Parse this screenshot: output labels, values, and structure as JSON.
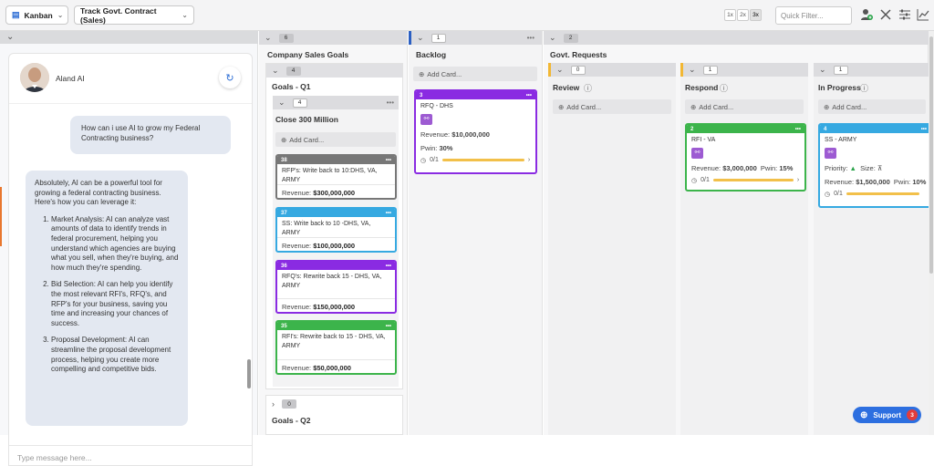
{
  "toolbar": {
    "view_label": "Kanban",
    "board_label": "Track Govt. Contract (Sales)",
    "zoom_levels": [
      "1x",
      "2x",
      "3x"
    ],
    "zoom_selected": "3x",
    "filter_placeholder": "Quick Filter...",
    "icons": [
      "add-user-icon",
      "tools-icon",
      "sliders-icon",
      "chart-icon"
    ]
  },
  "chat": {
    "assistant_name": "Aland AI",
    "user_message": "How can i use AI to grow my Federal Contracting business?",
    "ai_intro": "Absolutely, AI can be a powerful tool for growing a federal contracting business. Here's how you can leverage it:",
    "ai_points": [
      "Market Analysis: AI can analyze vast amounts of data to identify trends in federal procurement, helping you understand which agencies are buying what you sell, when they're buying, and how much they're spending.",
      "Bid Selection: AI can help you identify the most relevant RFI's, RFQ's, and RFP's for your business, saving you time and increasing your chances of success.",
      "Proposal Development: AI can streamline the proposal development process, helping you create more compelling and competitive bids."
    ],
    "input_placeholder": "Type message here..."
  },
  "board": {
    "add_card": "Add Card...",
    "company": {
      "title": "Company Sales Goals",
      "count": "6",
      "q1": {
        "title": "Goals - Q1",
        "count": "4"
      },
      "close": {
        "title": "Close 300 Million",
        "count": "4"
      },
      "q2": {
        "title": "Goals - Q2",
        "count": "0"
      },
      "cards": [
        {
          "id": "38",
          "title": "RFP's: Write back to 10:DHS, VA, ARMY",
          "revenue_label": "Revenue:",
          "revenue": "$300,000,000",
          "color": "#777777"
        },
        {
          "id": "37",
          "title": "SS: Write back to 10 -DHS, VA, ARMY",
          "revenue_label": "Revenue:",
          "revenue": "$100,000,000",
          "color": "#36a9e1"
        },
        {
          "id": "36",
          "title": "RFQ's: Rewrite back 15 - DHS, VA, ARMY",
          "revenue_label": "Revenue:",
          "revenue": "$150,000,000",
          "color": "#8a2be2"
        },
        {
          "id": "35",
          "title": "RFI's: Rewrite back to 15 - DHS, VA, ARMY",
          "revenue_label": "Revenue:",
          "revenue": "$50,000,000",
          "color": "#3cb44b"
        }
      ]
    },
    "backlog": {
      "title": "Backlog",
      "count": "1",
      "card": {
        "id": "3",
        "title": "RFQ - DHS",
        "revenue_label": "Revenue:",
        "revenue": "$10,000,000",
        "pwin_label": "Pwin:",
        "pwin": "30%",
        "progress": "0/1",
        "color": "#8a2be2"
      }
    },
    "govt": {
      "title": "Govt. Requests",
      "count": "2",
      "review": {
        "title": "Review",
        "count": "0"
      },
      "respond": {
        "title": "Respond",
        "count": "1",
        "card": {
          "id": "2",
          "title": "RFI - VA",
          "revenue_label": "Revenue:",
          "revenue": "$3,000,000",
          "pwin_label": "Pwin:",
          "pwin": "15%",
          "progress": "0/1",
          "color": "#3cb44b"
        }
      },
      "inprogress": {
        "title": "In Progress",
        "count": "1",
        "card": {
          "id": "4",
          "title": "SS - ARMY",
          "priority_label": "Priority:",
          "size_label": "Size:",
          "revenue_label": "Revenue:",
          "revenue": "$1,500,000",
          "pwin_label": "Pwin:",
          "pwin": "10%",
          "progress": "0/1",
          "color": "#36a9e1"
        }
      }
    }
  },
  "support": {
    "label": "Support",
    "badge": "3"
  }
}
